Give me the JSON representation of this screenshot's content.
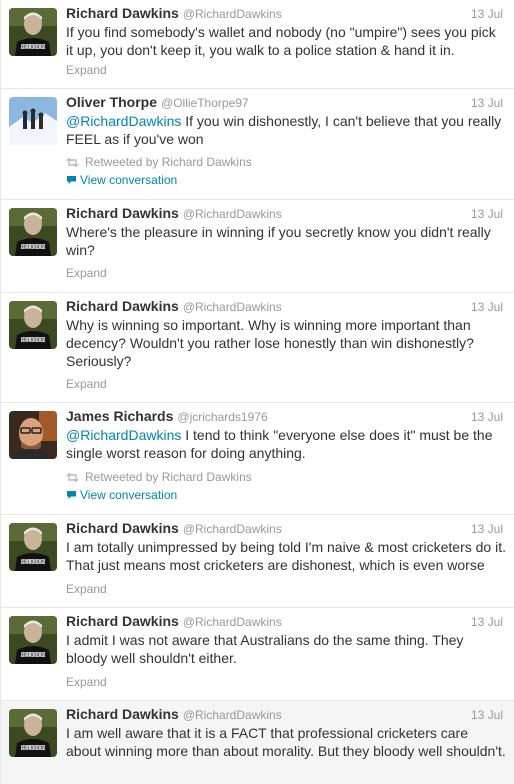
{
  "tweets": [
    {
      "fullname": "Richard Dawkins",
      "username": "@RichardDawkins",
      "time": "13 Jul",
      "text": "If you find somebody's wallet and nobody (no \"umpire\") sees you pick it up, you don't keep it, you walk to a police station & hand it in.",
      "expand": "Expand"
    },
    {
      "fullname": "Oliver Thorpe",
      "username": "@OllieThorpe97",
      "time": "13 Jul",
      "mention": "@RichardDawkins",
      "text": " If you win dishonestly, I can't believe that you really FEEL as if you've won",
      "retweeted_by": "Retweeted by Richard Dawkins",
      "view_conversation": "View conversation"
    },
    {
      "fullname": "Richard Dawkins",
      "username": "@RichardDawkins",
      "time": "13 Jul",
      "text": "Where's the pleasure in winning if you secretly know you didn't really win?",
      "expand": "Expand"
    },
    {
      "fullname": "Richard Dawkins",
      "username": "@RichardDawkins",
      "time": "13 Jul",
      "text": "Why is winning so important. Why is winning more important than decency? Wouldn't you rather lose honestly than win dishonestly? Seriously?",
      "expand": "Expand"
    },
    {
      "fullname": "James Richards",
      "username": "@jcrichards1976",
      "time": "13 Jul",
      "mention": "@RichardDawkins",
      "text": " I tend to think \"everyone else does it\" must be the single worst reason for doing anything.",
      "retweeted_by": "Retweeted by Richard Dawkins",
      "view_conversation": "View conversation"
    },
    {
      "fullname": "Richard Dawkins",
      "username": "@RichardDawkins",
      "time": "13 Jul",
      "text": "I am totally unimpressed by being told I'm naive & most cricketers do it. That just means most cricketers are dishonest, which is even worse",
      "expand": "Expand"
    },
    {
      "fullname": "Richard Dawkins",
      "username": "@RichardDawkins",
      "time": "13 Jul",
      "text": "I admit I was not aware that Australians do the same thing. They bloody well shouldn't either.",
      "expand": "Expand"
    },
    {
      "fullname": "Richard Dawkins",
      "username": "@RichardDawkins",
      "time": "13 Jul",
      "text": "I am well aware that it is a FACT that professional cricketers care about winning more than about morality. But they bloody well shouldn't."
    }
  ],
  "colors": {
    "link": "#0084b4",
    "muted": "#999999",
    "text": "#333333",
    "divider": "#e8e8e8"
  },
  "avatar_text": "RELIGION"
}
